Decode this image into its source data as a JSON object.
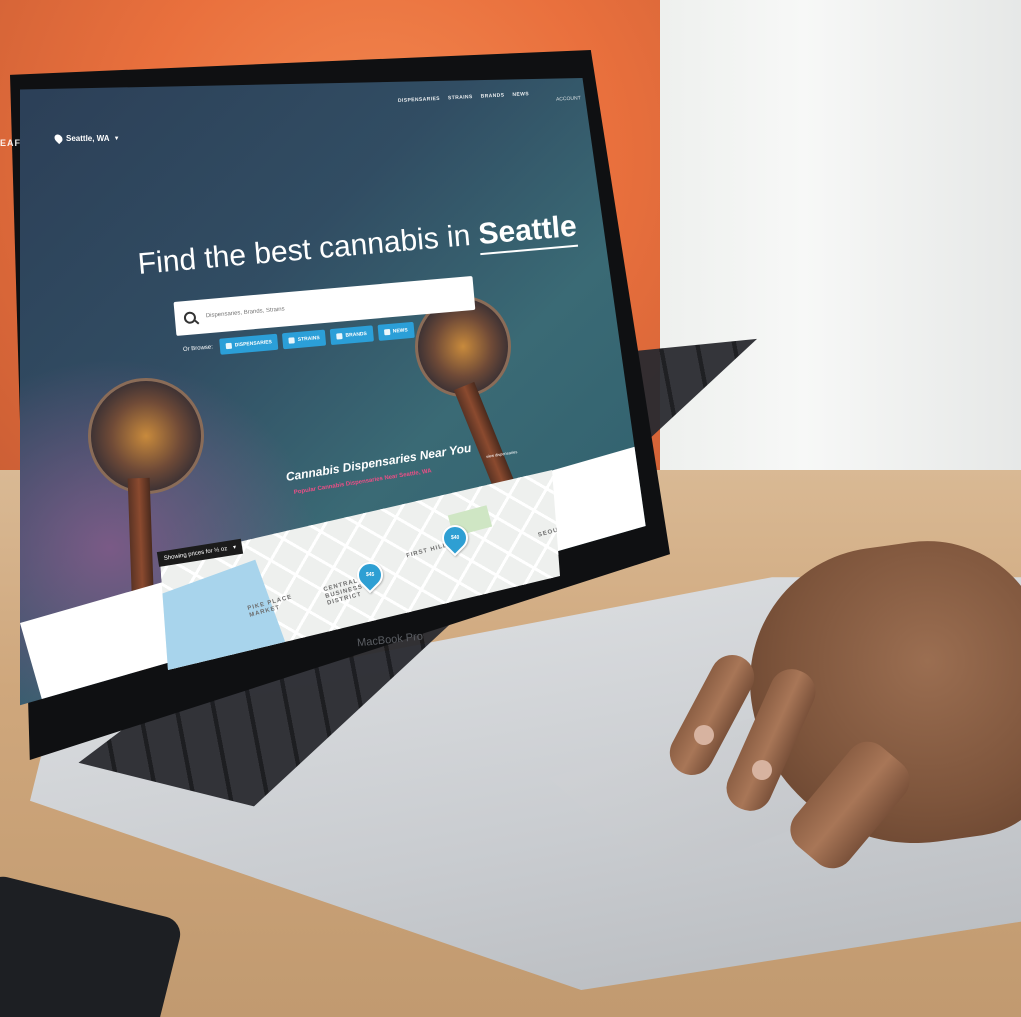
{
  "device": {
    "model_label": "MacBook Pro"
  },
  "website": {
    "brand": "EAF",
    "location": {
      "city_state": "Seattle, WA"
    },
    "nav": {
      "items": [
        {
          "label": "DISPENSARIES"
        },
        {
          "label": "STRAINS"
        },
        {
          "label": "BRANDS"
        },
        {
          "label": "NEWS"
        }
      ],
      "account": "ACCOUNT"
    },
    "hero": {
      "title_prefix": "Find the best cannabis in",
      "title_city": "Seattle",
      "search_placeholder": "Dispensaries, Brands, Strains",
      "browse_label": "Or Browse:",
      "browse_buttons": [
        {
          "label": "DISPENSARIES"
        },
        {
          "label": "STRAINS"
        },
        {
          "label": "BRANDS"
        },
        {
          "label": "NEWS"
        }
      ]
    },
    "dispensaries_section": {
      "title": "Cannabis Dispensaries Near You",
      "subtitle": "Popular Cannabis Dispensaries Near Seattle, WA",
      "link": "view dispensaries"
    },
    "map": {
      "price_badge": "Showing prices for ½ oz",
      "price_badge_chevron": "▾",
      "labels": [
        {
          "text": "PIKE PLACE\nMARKET"
        },
        {
          "text": "CENTRAL\nBUSINESS\nDISTRICT"
        },
        {
          "text": "FIRST HILL"
        },
        {
          "text": "SEOU"
        }
      ],
      "pins": [
        {
          "price": "$45"
        },
        {
          "price": "$40"
        }
      ]
    }
  },
  "colors": {
    "accent_blue": "#2b9fd8",
    "accent_pink": "#ec4f86",
    "wall_orange": "#e9703d"
  }
}
